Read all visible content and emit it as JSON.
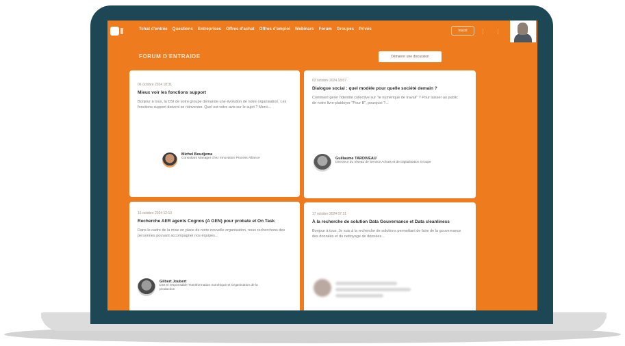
{
  "nav": {
    "links": [
      "Tchat d'entrée",
      "Questions",
      "Entreprises",
      "Offres d'achat",
      "Offres d'emploi",
      "Webinars",
      "Forum",
      "Groupes",
      "Privés"
    ],
    "cta_label": "Inscrit"
  },
  "forum": {
    "title": "FORUM D'ENTRAIDE",
    "new_topic_label": "Démarrer une discussion"
  },
  "cards": [
    {
      "date": "06 octobre 2024 18:31",
      "title": "Mieux voir les fonctions support",
      "excerpt": "Bonjour à tous, la DSI de votre groupe demande une évolution de notre organisation. Les fonctions support doivent se réinventer. Quel est votre avis sur le sujet ? Merci...",
      "author": {
        "name": "Michel Boudjema",
        "role": "Consultant Manager chez Innovation Process Alliance",
        "photo": "author-photo"
      }
    },
    {
      "date": "02 octobre 2024 18:07",
      "title": "Dialogue social : quel modèle pour quelle société demain ?",
      "excerpt": "Comment gérer l'identité collective sur \"le numérique de travail\" ? Pour laisser au public de notre livre-plaidoyer \"Pour B\", pourquoi ?...",
      "author": {
        "name": "Guillaume TARDIVEAU",
        "role": "Directeur du réseau de Service Achats et de Digitalisation Groupe",
        "photo": "author-photo"
      }
    },
    {
      "date": "16 octobre 2024 12:10",
      "title": "Recherche AER agents Cognos (A GEN) pour probate et On Task",
      "excerpt": "Dans le cadre de la mise en place de notre nouvelle organisation, nous recherchons des personnes pouvant accompagner nos équipes...",
      "author": {
        "name": "Gilbert Joubert",
        "role": "DSI et responsable Transformation numérique et Organisation de la production",
        "photo": "author-photo"
      }
    },
    {
      "date": "17 octobre 2024 07:31",
      "title": "À la recherche de solution Data Gouvernance et Data cleanliness",
      "excerpt": "Bonjour à tous, Je suis à la recherche de solutions permettant de faire de la gouvernance des données et du nettoyage de données...",
      "author": {
        "name": "",
        "role": "",
        "photo": "blurred"
      }
    }
  ],
  "colors": {
    "screen_bg": "#ef7b1f",
    "laptop_frame": "#1e4755",
    "card_bg": "#ffffff"
  }
}
